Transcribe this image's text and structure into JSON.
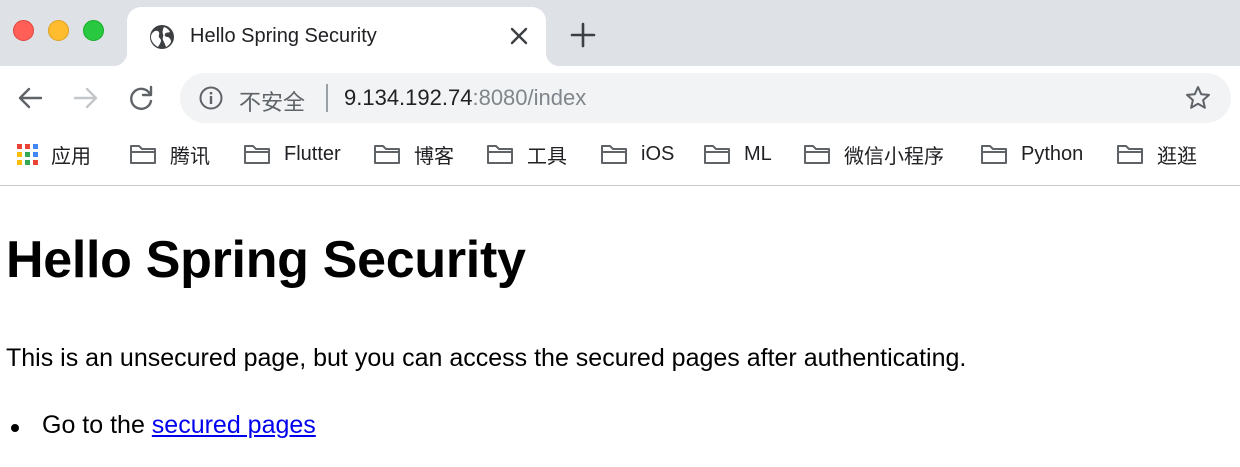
{
  "window": {
    "traffic_lights": [
      "close",
      "minimize",
      "zoom"
    ]
  },
  "tab": {
    "title": "Hello Spring Security",
    "favicon": "globe-icon",
    "close_icon": "close-icon"
  },
  "toolbar": {
    "back_icon": "arrow-left-icon",
    "forward_icon": "arrow-right-icon",
    "reload_icon": "reload-icon",
    "security_label": "不安全",
    "url_host": "9.134.192.74",
    "url_rest": ":8080/index",
    "bookmark_star_icon": "star-icon"
  },
  "bookmarks": {
    "apps_label": "应用",
    "folders": [
      "腾讯",
      "Flutter",
      "博客",
      "工具",
      "iOS",
      "ML",
      "微信小程序",
      "Python",
      "逛逛"
    ]
  },
  "page": {
    "heading": "Hello Spring Security",
    "paragraph": "This is an unsecured page, but you can access the secured pages after authenticating.",
    "list_item_prefix": "Go to the ",
    "list_item_link": "secured pages"
  },
  "colors": {
    "tabstrip_bg": "#dee1e6",
    "omnibox_bg": "#f1f3f4",
    "link": "#0000ee",
    "close_light": "#ff5f57",
    "minimize_light": "#febc2e",
    "zoom_light": "#28c840"
  }
}
